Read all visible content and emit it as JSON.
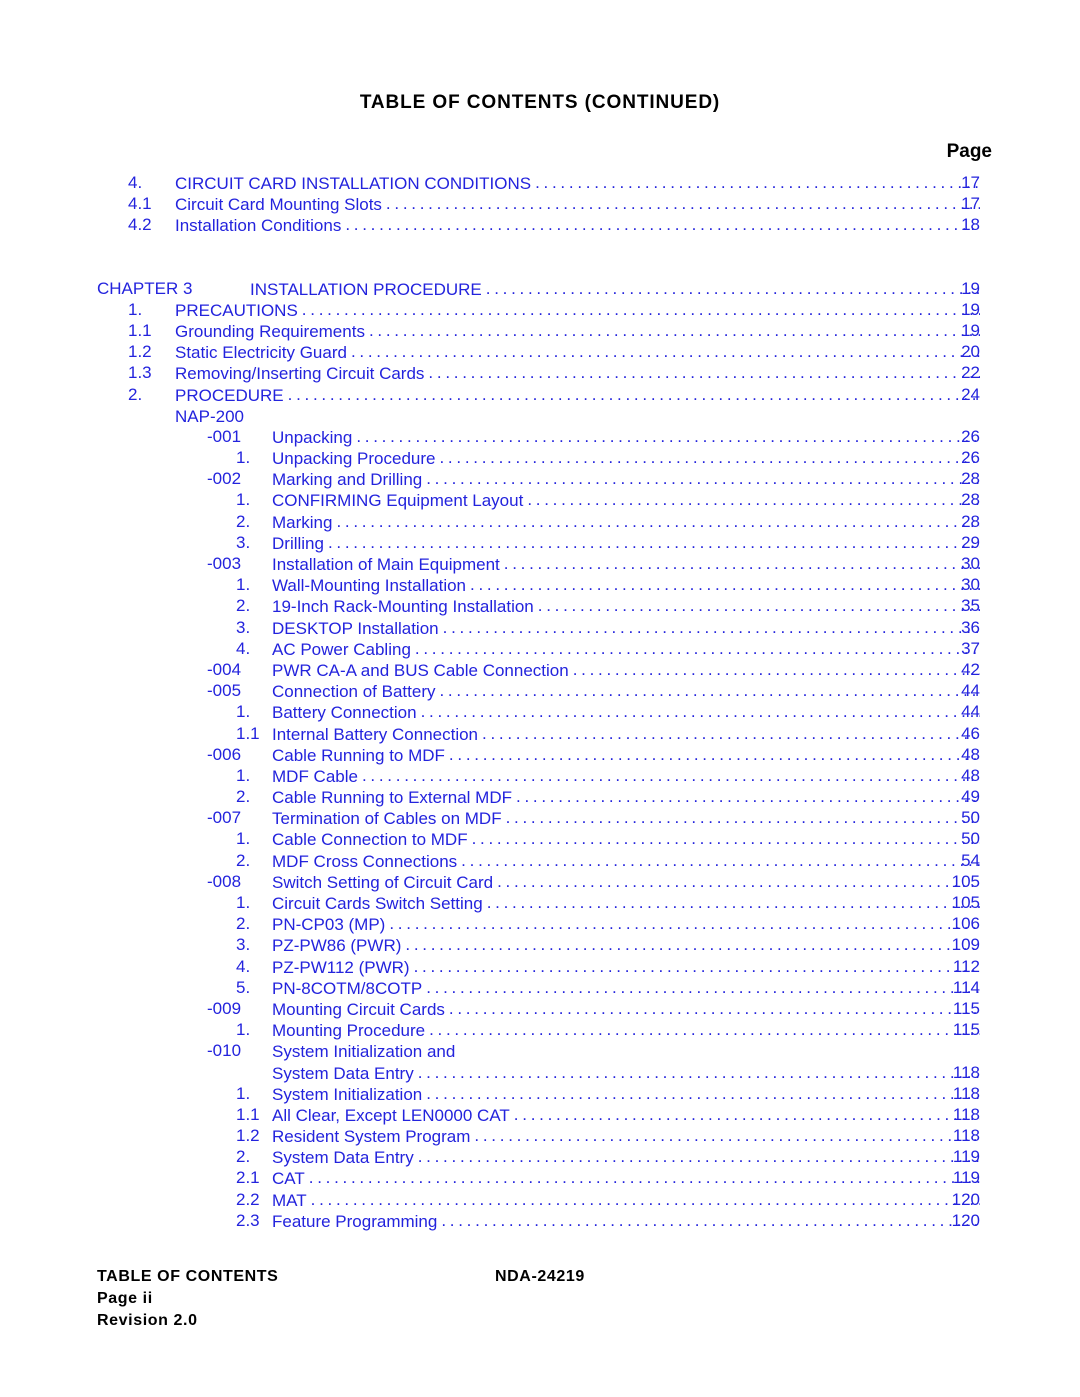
{
  "document": {
    "title": "TABLE OF CONTENTS (CONTINUED)",
    "page_column_header": "Page"
  },
  "footer": {
    "section": "TABLE OF CONTENTS",
    "doc_number": "NDA-24219",
    "page": "Page ii",
    "revision": "Revision 2.0"
  },
  "toc": {
    "entries": [
      {
        "level": "lvl-1",
        "num": "4.",
        "label": "CIRCUIT CARD INSTALLATION CONDITIONS",
        "page": "17",
        "leader": true,
        "gap": false
      },
      {
        "level": "lvl-1",
        "num": "4.1",
        "label": "Circuit Card Mounting Slots",
        "page": "17",
        "leader": true,
        "gap": false
      },
      {
        "level": "lvl-1",
        "num": "4.2",
        "label": "Installation Conditions",
        "page": "18",
        "leader": true,
        "gap": false
      },
      {
        "level": "lvl-chapter",
        "num": "CHAPTER 3",
        "label": "INSTALLATION PROCEDURE",
        "page": "19",
        "leader": true,
        "gap": true
      },
      {
        "level": "lvl-1",
        "num": "1.",
        "label": "PRECAUTIONS",
        "page": "19",
        "leader": true,
        "gap": false
      },
      {
        "level": "lvl-1",
        "num": "1.1",
        "label": "Grounding Requirements",
        "page": "19",
        "leader": true,
        "gap": false
      },
      {
        "level": "lvl-1",
        "num": "1.2",
        "label": "Static Electricity Guard",
        "page": "20",
        "leader": true,
        "gap": false
      },
      {
        "level": "lvl-1",
        "num": "1.3",
        "label": "Removing/Inserting Circuit Cards",
        "page": "22",
        "leader": true,
        "gap": false
      },
      {
        "level": "lvl-1",
        "num": "2.",
        "label": "PROCEDURE",
        "page": "24",
        "leader": true,
        "gap": false
      },
      {
        "level": "lvl-plain",
        "num": "",
        "label": "NAP-200",
        "page": "",
        "leader": false,
        "gap": false
      },
      {
        "level": "lvl-nap",
        "num": "-001",
        "label": "Unpacking",
        "page": "26",
        "leader": true,
        "gap": false
      },
      {
        "level": "lvl-sub",
        "num": "1.",
        "label": "Unpacking Procedure",
        "page": "26",
        "leader": true,
        "gap": false
      },
      {
        "level": "lvl-nap",
        "num": "-002",
        "label": "Marking and Drilling",
        "page": "28",
        "leader": true,
        "gap": false
      },
      {
        "level": "lvl-sub",
        "num": "1.",
        "label": "CONFIRMING Equipment Layout",
        "page": "28",
        "leader": true,
        "gap": false
      },
      {
        "level": "lvl-sub",
        "num": "2.",
        "label": "Marking",
        "page": "28",
        "leader": true,
        "gap": false
      },
      {
        "level": "lvl-sub",
        "num": "3.",
        "label": "Drilling",
        "page": "29",
        "leader": true,
        "gap": false
      },
      {
        "level": "lvl-nap",
        "num": "-003",
        "label": "Installation of Main Equipment",
        "page": "30",
        "leader": true,
        "gap": false
      },
      {
        "level": "lvl-sub",
        "num": "1.",
        "label": "Wall-Mounting Installation",
        "page": "30",
        "leader": true,
        "gap": false
      },
      {
        "level": "lvl-sub",
        "num": "2.",
        "label": "19-Inch Rack-Mounting Installation",
        "page": "35",
        "leader": true,
        "gap": false
      },
      {
        "level": "lvl-sub",
        "num": "3.",
        "label": "DESKTOP Installation",
        "page": "36",
        "leader": true,
        "gap": false
      },
      {
        "level": "lvl-sub",
        "num": "4.",
        "label": "AC Power Cabling",
        "page": "37",
        "leader": true,
        "gap": false
      },
      {
        "level": "lvl-nap",
        "num": "-004",
        "label": "PWR CA-A and BUS Cable Connection",
        "page": "42",
        "leader": true,
        "gap": false
      },
      {
        "level": "lvl-nap",
        "num": "-005",
        "label": "Connection of Battery",
        "page": "44",
        "leader": true,
        "gap": false
      },
      {
        "level": "lvl-sub",
        "num": "1.",
        "label": "Battery Connection",
        "page": "44",
        "leader": true,
        "gap": false
      },
      {
        "level": "lvl-sub",
        "num": "1.1",
        "label": "Internal Battery Connection",
        "page": "46",
        "leader": true,
        "gap": false
      },
      {
        "level": "lvl-nap",
        "num": "-006",
        "label": "Cable Running to MDF",
        "page": "48",
        "leader": true,
        "gap": false
      },
      {
        "level": "lvl-sub",
        "num": "1.",
        "label": "MDF Cable",
        "page": "48",
        "leader": true,
        "gap": false
      },
      {
        "level": "lvl-sub",
        "num": "2.",
        "label": "Cable Running to External MDF",
        "page": "49",
        "leader": true,
        "gap": false
      },
      {
        "level": "lvl-nap",
        "num": "-007",
        "label": "Termination of Cables on MDF",
        "page": "50",
        "leader": true,
        "gap": false
      },
      {
        "level": "lvl-sub",
        "num": "1.",
        "label": "Cable Connection to MDF",
        "page": "50",
        "leader": true,
        "gap": false
      },
      {
        "level": "lvl-sub",
        "num": "2.",
        "label": "MDF Cross Connections",
        "page": "54",
        "leader": true,
        "gap": false
      },
      {
        "level": "lvl-nap",
        "num": "-008",
        "label": "Switch Setting of Circuit Card",
        "page": "105",
        "leader": true,
        "gap": false
      },
      {
        "level": "lvl-sub",
        "num": "1.",
        "label": "Circuit Cards Switch Setting",
        "page": "105",
        "leader": true,
        "gap": false
      },
      {
        "level": "lvl-sub",
        "num": "2.",
        "label": "PN-CP03 (MP)",
        "page": "106",
        "leader": true,
        "gap": false
      },
      {
        "level": "lvl-sub",
        "num": "3.",
        "label": "PZ-PW86 (PWR)",
        "page": "109",
        "leader": true,
        "gap": false
      },
      {
        "level": "lvl-sub",
        "num": "4.",
        "label": "PZ-PW112 (PWR)",
        "page": "112",
        "leader": true,
        "gap": false
      },
      {
        "level": "lvl-sub",
        "num": "5.",
        "label": "PN-8COTM/8COTP",
        "page": "114",
        "leader": true,
        "gap": false
      },
      {
        "level": "lvl-nap",
        "num": "-009",
        "label": "Mounting Circuit Cards",
        "page": "115",
        "leader": true,
        "gap": false
      },
      {
        "level": "lvl-sub",
        "num": "1.",
        "label": "Mounting Procedure",
        "page": "115",
        "leader": true,
        "gap": false
      },
      {
        "level": "lvl-nap",
        "num": "-010",
        "label": "System Initialization and",
        "page": "",
        "leader": false,
        "gap": false
      },
      {
        "level": "lvl-cont",
        "num": "",
        "label": "System Data Entry",
        "page": "118",
        "leader": true,
        "gap": false
      },
      {
        "level": "lvl-sub",
        "num": "1.",
        "label": "System Initialization",
        "page": "118",
        "leader": true,
        "gap": false
      },
      {
        "level": "lvl-sub",
        "num": "1.1",
        "label": "All Clear, Except LEN0000 CAT",
        "page": "118",
        "leader": true,
        "gap": false
      },
      {
        "level": "lvl-sub",
        "num": "1.2",
        "label": "Resident System Program",
        "page": "118",
        "leader": true,
        "gap": false
      },
      {
        "level": "lvl-sub",
        "num": "2.",
        "label": "System Data Entry",
        "page": "119",
        "leader": true,
        "gap": false
      },
      {
        "level": "lvl-sub",
        "num": "2.1",
        "label": "CAT",
        "page": "119",
        "leader": true,
        "gap": false
      },
      {
        "level": "lvl-sub",
        "num": "2.2",
        "label": "MAT",
        "page": "120",
        "leader": true,
        "gap": false
      },
      {
        "level": "lvl-sub",
        "num": "2.3",
        "label": "Feature Programming",
        "page": "120",
        "leader": true,
        "gap": false
      }
    ]
  }
}
